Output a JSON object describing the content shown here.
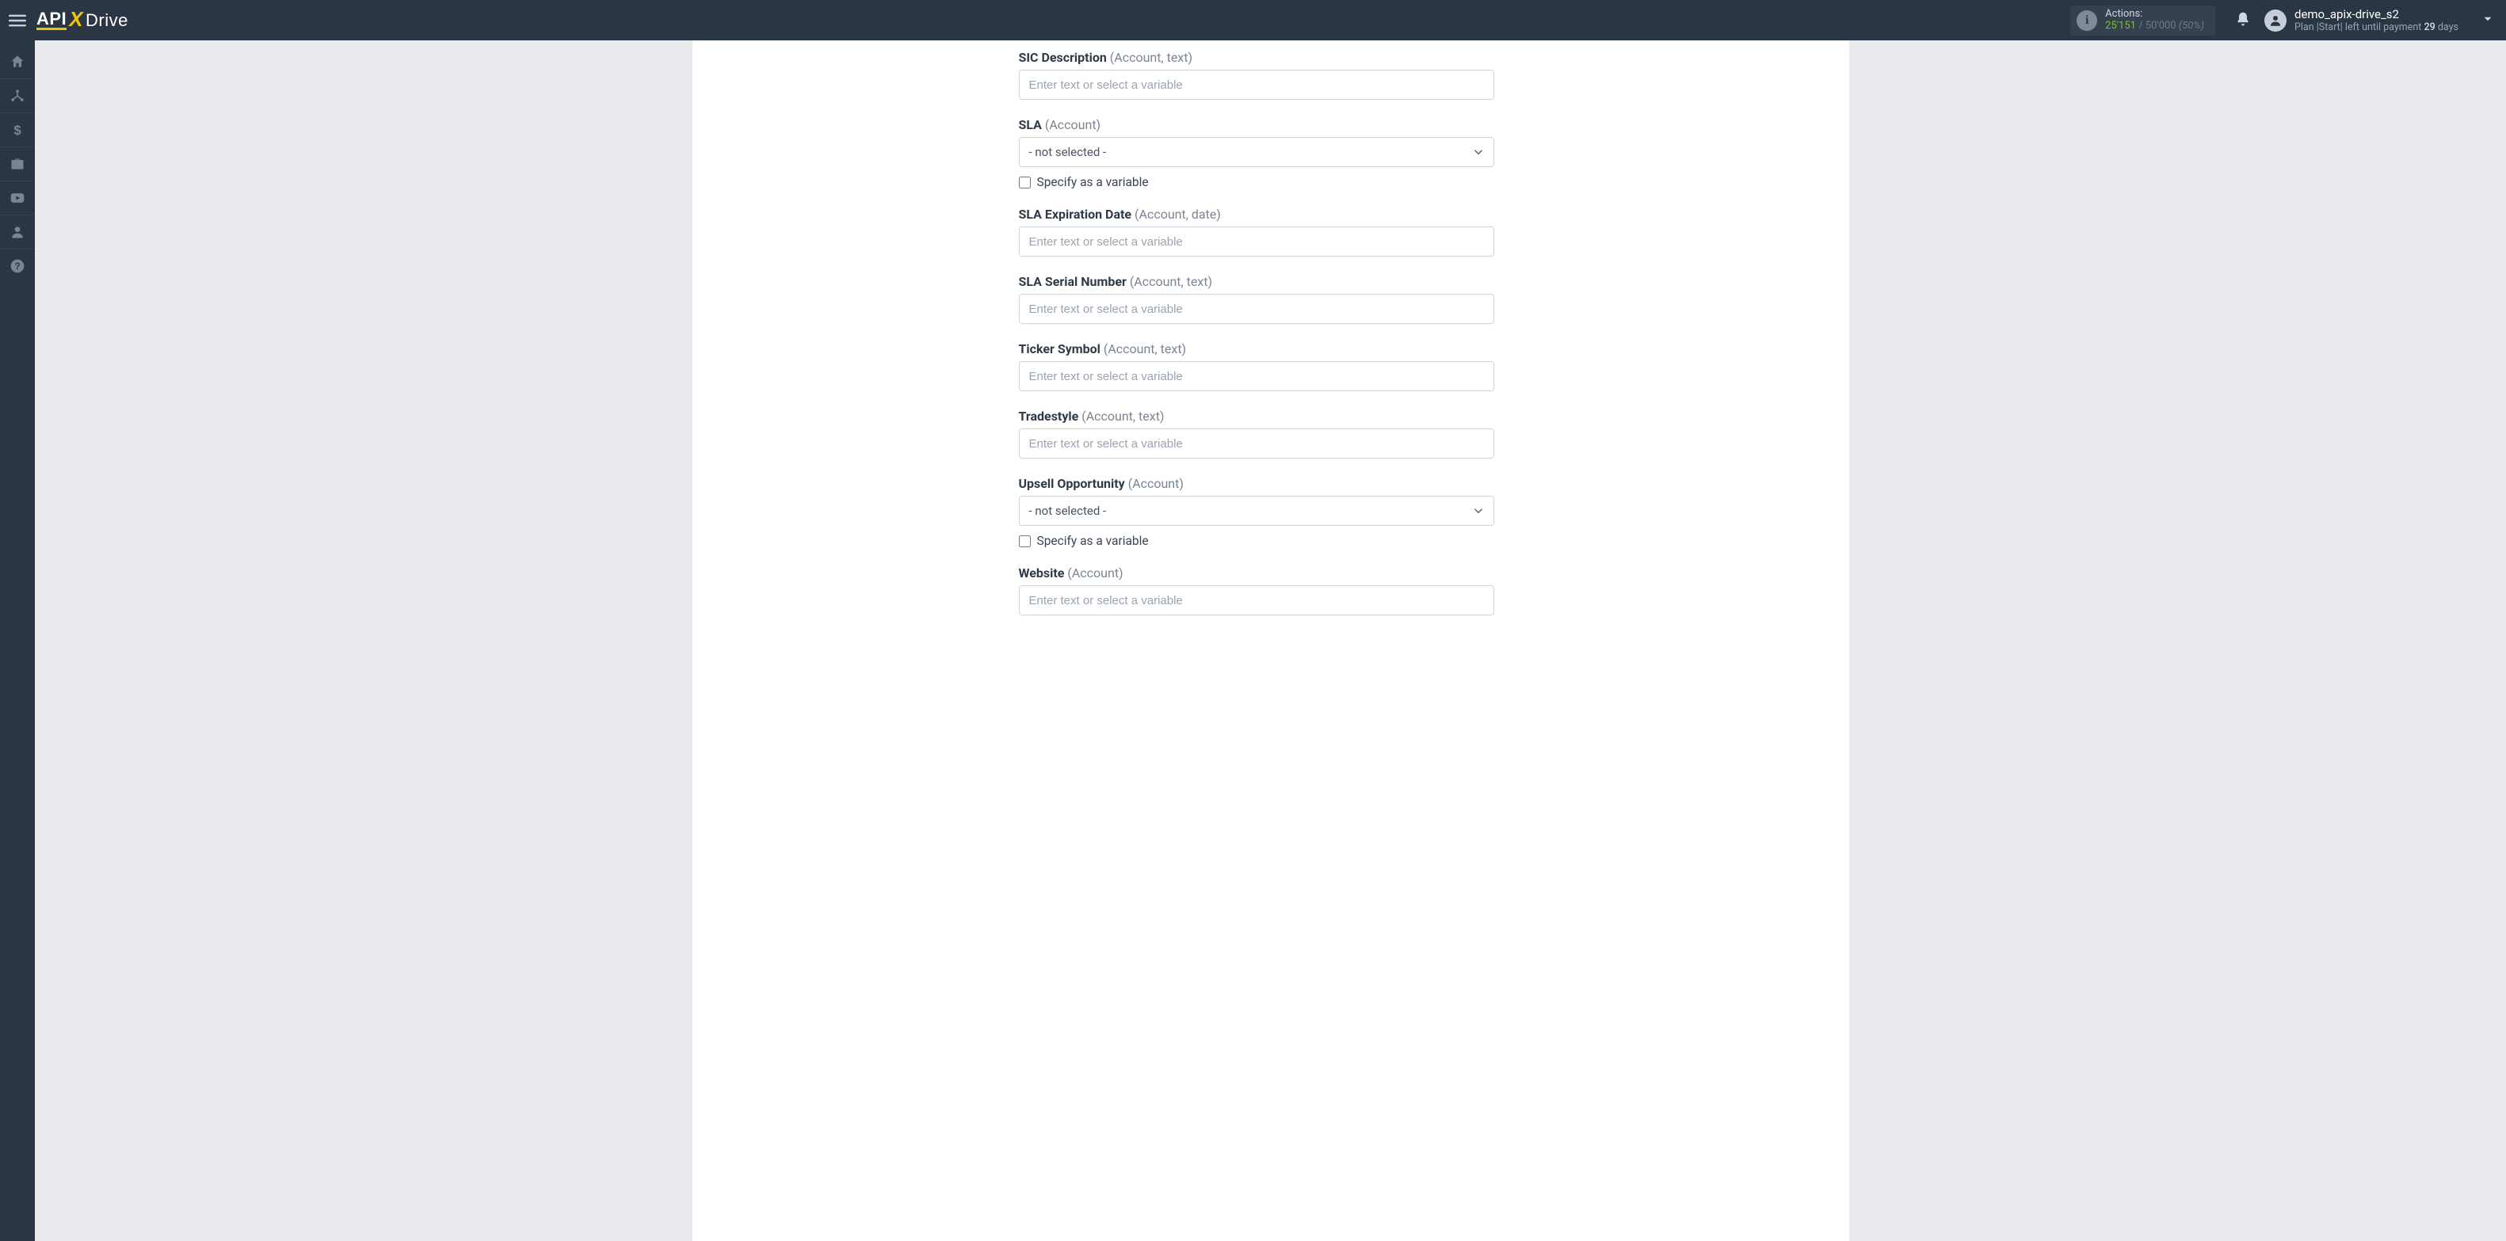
{
  "header": {
    "logo": {
      "part1": "API",
      "part2": "X",
      "part3": "Drive"
    },
    "actions": {
      "label": "Actions:",
      "used": "25'151",
      "slash": " / ",
      "limit": "50'000",
      "pct": "(50%)"
    },
    "user": {
      "name": "demo_apix-drive_s2",
      "plan_prefix": "Plan |",
      "plan_name": "Start",
      "plan_mid": "| left until payment ",
      "plan_days": "29",
      "plan_suffix": " days"
    }
  },
  "sidebar": {
    "items": [
      {
        "name": "home-icon"
      },
      {
        "name": "connections-icon"
      },
      {
        "name": "billing-icon"
      },
      {
        "name": "briefcase-icon"
      },
      {
        "name": "youtube-icon"
      },
      {
        "name": "account-icon"
      },
      {
        "name": "help-icon"
      }
    ]
  },
  "form": {
    "placeholder_text": "Enter text or select a variable",
    "select_placeholder": "- not selected -",
    "checkbox_label": "Specify as a variable",
    "fields": [
      {
        "id": "sic-description",
        "label": "SIC Description",
        "hint": "(Account, text)",
        "type": "text"
      },
      {
        "id": "sla",
        "label": "SLA",
        "hint": "(Account)",
        "type": "select"
      },
      {
        "id": "sla-expiration-date",
        "label": "SLA Expiration Date",
        "hint": "(Account, date)",
        "type": "text"
      },
      {
        "id": "sla-serial-number",
        "label": "SLA Serial Number",
        "hint": "(Account, text)",
        "type": "text"
      },
      {
        "id": "ticker-symbol",
        "label": "Ticker Symbol",
        "hint": "(Account, text)",
        "type": "text"
      },
      {
        "id": "tradestyle",
        "label": "Tradestyle",
        "hint": "(Account, text)",
        "type": "text"
      },
      {
        "id": "upsell-opportunity",
        "label": "Upsell Opportunity",
        "hint": "(Account)",
        "type": "select"
      },
      {
        "id": "website",
        "label": "Website",
        "hint": "(Account)",
        "type": "text"
      }
    ]
  }
}
